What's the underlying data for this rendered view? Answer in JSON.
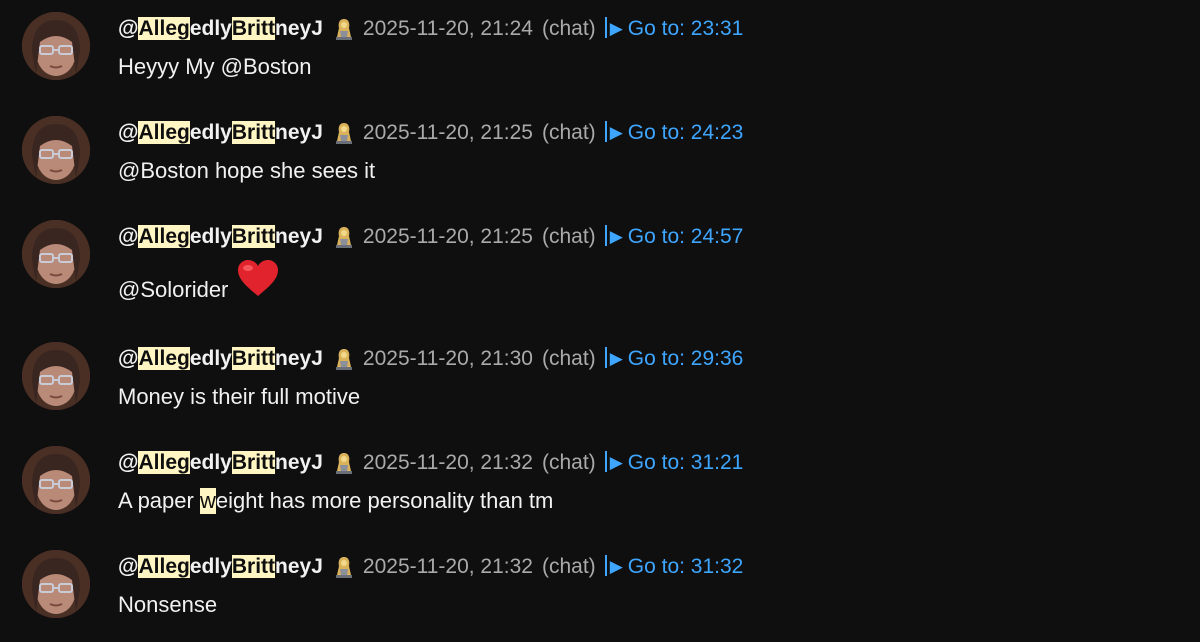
{
  "messages": [
    {
      "author_parts": [
        "@",
        "Alleg",
        "edly",
        "Britt",
        "neyJ"
      ],
      "timestamp": "2025-11-20, 21:24",
      "kind": "(chat)",
      "goto_label": "Go to: 23:31",
      "text_parts": [
        "Heyyy My @Boston"
      ],
      "emoji": ""
    },
    {
      "author_parts": [
        "@",
        "Alleg",
        "edly",
        "Britt",
        "neyJ"
      ],
      "timestamp": "2025-11-20, 21:25",
      "kind": "(chat)",
      "goto_label": "Go to: 24:23",
      "text_parts": [
        "@Boston hope she sees it"
      ],
      "emoji": ""
    },
    {
      "author_parts": [
        "@",
        "Alleg",
        "edly",
        "Britt",
        "neyJ"
      ],
      "timestamp": "2025-11-20, 21:25",
      "kind": "(chat)",
      "goto_label": "Go to: 24:57",
      "text_parts": [
        "@Solorider"
      ],
      "emoji": "red-heart"
    },
    {
      "author_parts": [
        "@",
        "Alleg",
        "edly",
        "Britt",
        "neyJ"
      ],
      "timestamp": "2025-11-20, 21:30",
      "kind": "(chat)",
      "goto_label": "Go to: 29:36",
      "text_parts": [
        "Money is their full motive"
      ],
      "emoji": ""
    },
    {
      "author_parts": [
        "@",
        "Alleg",
        "edly",
        "Britt",
        "neyJ"
      ],
      "timestamp": "2025-11-20, 21:32",
      "kind": "(chat)",
      "goto_label": "Go to: 31:21",
      "text_parts": [
        "A paper ",
        "w",
        "eight has more personality than tm"
      ],
      "emoji": ""
    },
    {
      "author_parts": [
        "@",
        "Alleg",
        "edly",
        "Britt",
        "neyJ"
      ],
      "timestamp": "2025-11-20, 21:32",
      "kind": "(chat)",
      "goto_label": "Go to: 31:32",
      "text_parts": [
        "Nonsense"
      ],
      "emoji": ""
    }
  ],
  "icons": {
    "avatar": "user-avatar-photo",
    "badge": "member-badge-icon",
    "goto": "play-triangle-icon"
  },
  "colors": {
    "background": "#0f0f0f",
    "text": "#f1f1f1",
    "muted": "#aaaaaa",
    "link": "#3ea6ff",
    "highlight": "#fff6c4"
  }
}
